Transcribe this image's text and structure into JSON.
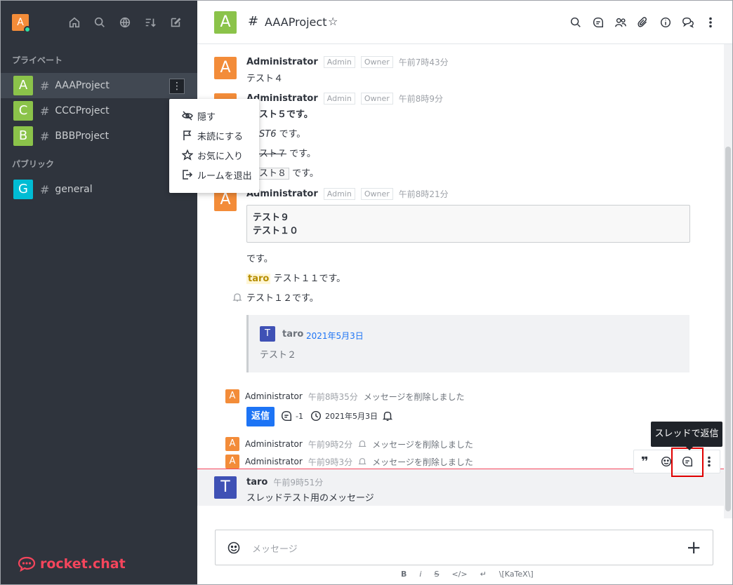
{
  "sidebar": {
    "avatar_letter": "A",
    "section_private": "プライベート",
    "section_public": "パブリック",
    "rooms_private": [
      {
        "letter": "A",
        "name": "AAAProject",
        "color": "#8bc34a"
      },
      {
        "letter": "C",
        "name": "CCCProject",
        "color": "#8bc34a"
      },
      {
        "letter": "B",
        "name": "BBBProject",
        "color": "#8bc34a"
      }
    ],
    "rooms_public": [
      {
        "letter": "G",
        "name": "general",
        "color": "#00bcd4"
      }
    ],
    "logo_text": "rocket.chat",
    "kebab": "⋮",
    "hash": "#"
  },
  "context_menu": {
    "items": [
      "隠す",
      "未読にする",
      "お気に入り",
      "ルームを退出"
    ]
  },
  "header": {
    "room_letter": "A",
    "hash": "#",
    "room_name": "AAAProject",
    "star": "☆"
  },
  "messages": {
    "m1": {
      "letter": "A",
      "user": "Administrator",
      "tag1": "Admin",
      "tag2": "Owner",
      "time": "午前7時43分",
      "text": "テスト４"
    },
    "m2": {
      "user": "Administrator",
      "tag1": "Admin",
      "tag2": "Owner",
      "time": "午前8時9分",
      "line1": "スト５です。",
      "line2a": "ST6",
      "line2b": "です。",
      "line3a": "スト７",
      "line3b": "です。",
      "line4a": "スト８",
      "line4b": "です。"
    },
    "m3": {
      "letter": "A",
      "user": "Administrator",
      "tag1": "Admin",
      "tag2": "Owner",
      "time": "午前8時21分",
      "code1": "テスト９",
      "code2": "テスト１０",
      "after_code": "です。",
      "mention": "taro",
      "mention_text": "テスト１１です。",
      "bell_text": "テスト１２です。"
    },
    "quote": {
      "letter": "T",
      "user": "taro",
      "date": "2021年5月3日",
      "text": "テスト２"
    },
    "sys1": {
      "letter": "A",
      "user": "Administrator",
      "time": "午前8時35分",
      "text": "メッセージを削除しました"
    },
    "thread": {
      "reply_label": "返信",
      "count": "-1",
      "date": "2021年5月3日"
    },
    "sys2": {
      "letter": "A",
      "user": "Administrator",
      "time": "午前9時2分",
      "text": "メッセージを削除しました"
    },
    "sys3": {
      "letter": "A",
      "user": "Administrator",
      "time": "午前9時3分",
      "text": "メッセージを削除しました"
    },
    "last": {
      "letter": "T",
      "user": "taro",
      "time": "午前9時51分",
      "text": "スレッドテスト用のメッセージ"
    }
  },
  "tooltip": "スレッドで返信",
  "composer": {
    "placeholder": "メッセージ",
    "plus": "+",
    "format": [
      "B",
      "i",
      "S",
      "</>",
      "↵",
      "\\[KaTeX\\]"
    ]
  },
  "colors": {
    "sidebar_bg": "#2f343d",
    "admin_orange": "#f38c39",
    "taro_blue": "#3f51b5",
    "room_green": "#8bc34a",
    "general_cyan": "#00bcd4",
    "brand_red": "#f5455c",
    "link_blue": "#1d74f5"
  }
}
